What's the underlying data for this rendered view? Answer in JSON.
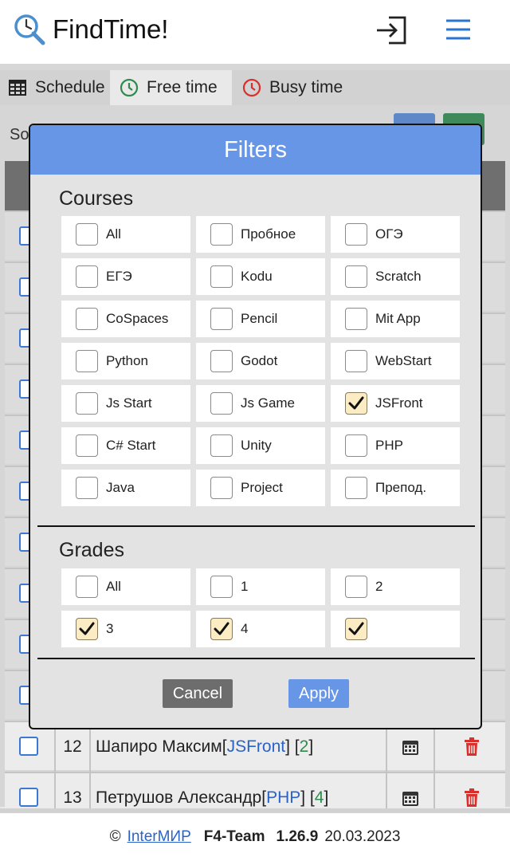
{
  "header": {
    "title": "FindTime!"
  },
  "tabs": [
    {
      "label": "Schedule"
    },
    {
      "label": "Free time"
    },
    {
      "label": "Busy time"
    }
  ],
  "background": {
    "so_label": "So",
    "rows": [
      {
        "num": "12",
        "name": "Шапиро Максим ",
        "course": "JSFront",
        "grade": "2"
      },
      {
        "num": "13",
        "name": "Петрушов Александр ",
        "course": "PHP",
        "grade": "4"
      }
    ]
  },
  "modal": {
    "title": "Filters",
    "courses_title": "Courses",
    "courses": [
      {
        "label": "All",
        "checked": false
      },
      {
        "label": "Пробное",
        "checked": false
      },
      {
        "label": "ОГЭ",
        "checked": false
      },
      {
        "label": "ЕГЭ",
        "checked": false
      },
      {
        "label": "Kodu",
        "checked": false
      },
      {
        "label": "Scratch",
        "checked": false
      },
      {
        "label": "CoSpaces",
        "checked": false
      },
      {
        "label": "Pencil",
        "checked": false
      },
      {
        "label": "Mit App",
        "checked": false
      },
      {
        "label": "Python",
        "checked": false
      },
      {
        "label": "Godot",
        "checked": false
      },
      {
        "label": "WebStart",
        "checked": false
      },
      {
        "label": "Js Start",
        "checked": false
      },
      {
        "label": "Js Game",
        "checked": false
      },
      {
        "label": "JSFront",
        "checked": true
      },
      {
        "label": "C# Start",
        "checked": false
      },
      {
        "label": "Unity",
        "checked": false
      },
      {
        "label": "PHP",
        "checked": false
      },
      {
        "label": "Java",
        "checked": false
      },
      {
        "label": "Project",
        "checked": false
      },
      {
        "label": "Препод.",
        "checked": false
      }
    ],
    "grades_title": "Grades",
    "grades": [
      {
        "label": "All",
        "checked": false
      },
      {
        "label": "1",
        "checked": false
      },
      {
        "label": "2",
        "checked": false
      },
      {
        "label": "3",
        "checked": true
      },
      {
        "label": "4",
        "checked": true
      },
      {
        "label": "",
        "checked": true
      }
    ],
    "cancel_label": "Cancel",
    "apply_label": "Apply"
  },
  "footer": {
    "copyright": "©",
    "link": "InterМИР",
    "team": "F4-Team",
    "version": "1.26.9",
    "date": "20.03.2023"
  },
  "colors": {
    "accent_blue": "#6896e7",
    "checked_bg": "#fbecc4",
    "link_blue": "#2a63c7",
    "grade_green": "#2f8a4d",
    "trash_red": "#d9302c"
  }
}
